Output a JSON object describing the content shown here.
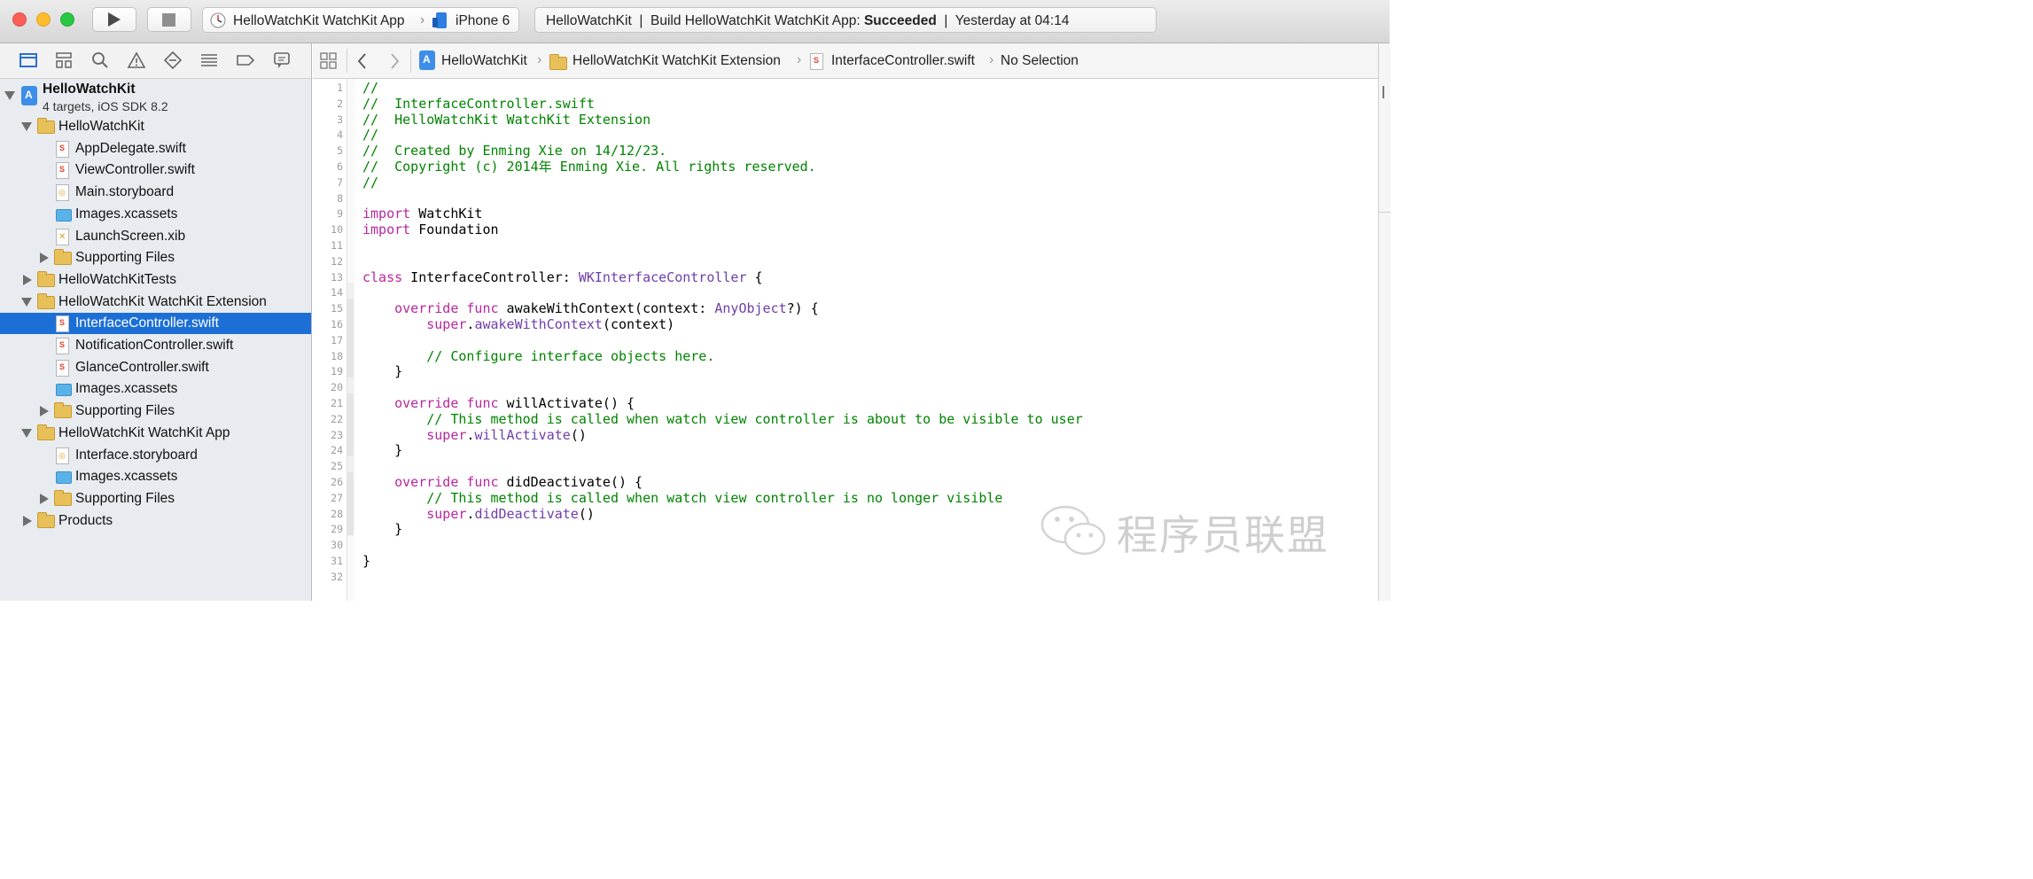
{
  "toolbar": {
    "scheme": {
      "target": "HelloWatchKit WatchKit App",
      "device": "iPhone 6"
    },
    "activity": {
      "prefix": "HelloWatchKit  |  Build HelloWatchKit WatchKit App: ",
      "status": "Succeeded",
      "suffix": "  |  Yesterday at 04:14"
    }
  },
  "navigator": {
    "project": {
      "name": "HelloWatchKit",
      "subtitle": "4 targets, iOS SDK 8.2"
    },
    "rows": [
      {
        "label": "HelloWatchKit",
        "kind": "folder",
        "disclosure": "open",
        "indent": 1
      },
      {
        "label": "AppDelegate.swift",
        "kind": "swift",
        "disclosure": "none",
        "indent": 2
      },
      {
        "label": "ViewController.swift",
        "kind": "swift",
        "disclosure": "none",
        "indent": 2
      },
      {
        "label": "Main.storyboard",
        "kind": "storyboard",
        "disclosure": "none",
        "indent": 2
      },
      {
        "label": "Images.xcassets",
        "kind": "assets",
        "disclosure": "none",
        "indent": 2
      },
      {
        "label": "LaunchScreen.xib",
        "kind": "xib",
        "disclosure": "none",
        "indent": 2
      },
      {
        "label": "Supporting Files",
        "kind": "folder",
        "disclosure": "closed",
        "indent": 2
      },
      {
        "label": "HelloWatchKitTests",
        "kind": "folder",
        "disclosure": "closed",
        "indent": 1
      },
      {
        "label": "HelloWatchKit WatchKit Extension",
        "kind": "folder",
        "disclosure": "open",
        "indent": 1
      },
      {
        "label": "InterfaceController.swift",
        "kind": "swift",
        "disclosure": "none",
        "indent": 2,
        "selected": true
      },
      {
        "label": "NotificationController.swift",
        "kind": "swift",
        "disclosure": "none",
        "indent": 2
      },
      {
        "label": "GlanceController.swift",
        "kind": "swift",
        "disclosure": "none",
        "indent": 2
      },
      {
        "label": "Images.xcassets",
        "kind": "assets",
        "disclosure": "none",
        "indent": 2
      },
      {
        "label": "Supporting Files",
        "kind": "folder",
        "disclosure": "closed",
        "indent": 2
      },
      {
        "label": "HelloWatchKit WatchKit App",
        "kind": "folder",
        "disclosure": "open",
        "indent": 1
      },
      {
        "label": "Interface.storyboard",
        "kind": "storyboard",
        "disclosure": "none",
        "indent": 2
      },
      {
        "label": "Images.xcassets",
        "kind": "assets",
        "disclosure": "none",
        "indent": 2
      },
      {
        "label": "Supporting Files",
        "kind": "folder",
        "disclosure": "closed",
        "indent": 2
      },
      {
        "label": "Products",
        "kind": "folder",
        "disclosure": "closed",
        "indent": 1
      }
    ]
  },
  "jumpbar": {
    "project": "HelloWatchKit",
    "group": "HelloWatchKit WatchKit Extension",
    "file": "InterfaceController.swift",
    "symbol": "No Selection"
  },
  "editor": {
    "lines": [
      [
        [
          "cm",
          "//"
        ]
      ],
      [
        [
          "cm",
          "//  InterfaceController.swift"
        ]
      ],
      [
        [
          "cm",
          "//  HelloWatchKit WatchKit Extension"
        ]
      ],
      [
        [
          "cm",
          "//"
        ]
      ],
      [
        [
          "cm",
          "//  Created by Enming Xie on 14/12/23."
        ]
      ],
      [
        [
          "cm",
          "//  Copyright (c) 2014年 Enming Xie. All rights reserved."
        ]
      ],
      [
        [
          "cm",
          "//"
        ]
      ],
      [],
      [
        [
          "kw",
          "import"
        ],
        [
          "pl",
          " WatchKit"
        ]
      ],
      [
        [
          "kw",
          "import"
        ],
        [
          "pl",
          " Foundation"
        ]
      ],
      [],
      [],
      [
        [
          "kw",
          "class"
        ],
        [
          "pl",
          " InterfaceController: "
        ],
        [
          "ty",
          "WKInterfaceController"
        ],
        [
          "pl",
          " {"
        ]
      ],
      [],
      [
        [
          "pl",
          "    "
        ],
        [
          "kw",
          "override"
        ],
        [
          "pl",
          " "
        ],
        [
          "kw",
          "func"
        ],
        [
          "pl",
          " awakeWithContext(context: "
        ],
        [
          "ty",
          "AnyObject"
        ],
        [
          "pl",
          "?) {"
        ]
      ],
      [
        [
          "pl",
          "        "
        ],
        [
          "kw",
          "super"
        ],
        [
          "pl",
          "."
        ],
        [
          "ty",
          "awakeWithContext"
        ],
        [
          "pl",
          "(context)"
        ]
      ],
      [],
      [
        [
          "pl",
          "        "
        ],
        [
          "cm",
          "// Configure interface objects here."
        ]
      ],
      [
        [
          "pl",
          "    }"
        ]
      ],
      [],
      [
        [
          "pl",
          "    "
        ],
        [
          "kw",
          "override"
        ],
        [
          "pl",
          " "
        ],
        [
          "kw",
          "func"
        ],
        [
          "pl",
          " willActivate() {"
        ]
      ],
      [
        [
          "pl",
          "        "
        ],
        [
          "cm",
          "// This method is called when watch view controller is about to be visible to user"
        ]
      ],
      [
        [
          "pl",
          "        "
        ],
        [
          "kw",
          "super"
        ],
        [
          "pl",
          "."
        ],
        [
          "ty",
          "willActivate"
        ],
        [
          "pl",
          "()"
        ]
      ],
      [
        [
          "pl",
          "    }"
        ]
      ],
      [],
      [
        [
          "pl",
          "    "
        ],
        [
          "kw",
          "override"
        ],
        [
          "pl",
          " "
        ],
        [
          "kw",
          "func"
        ],
        [
          "pl",
          " didDeactivate() {"
        ]
      ],
      [
        [
          "pl",
          "        "
        ],
        [
          "cm",
          "// This method is called when watch view controller is no longer visible"
        ]
      ],
      [
        [
          "pl",
          "        "
        ],
        [
          "kw",
          "super"
        ],
        [
          "pl",
          "."
        ],
        [
          "ty",
          "didDeactivate"
        ],
        [
          "pl",
          "()"
        ]
      ],
      [
        [
          "pl",
          "    }"
        ]
      ],
      [],
      [
        [
          "pl",
          "}"
        ]
      ],
      []
    ]
  },
  "watermark": {
    "text": "程序员联盟"
  },
  "colors": {
    "selection": "#1b6fd6",
    "comment": "#008400",
    "keyword": "#b8279d",
    "type": "#703daa"
  }
}
